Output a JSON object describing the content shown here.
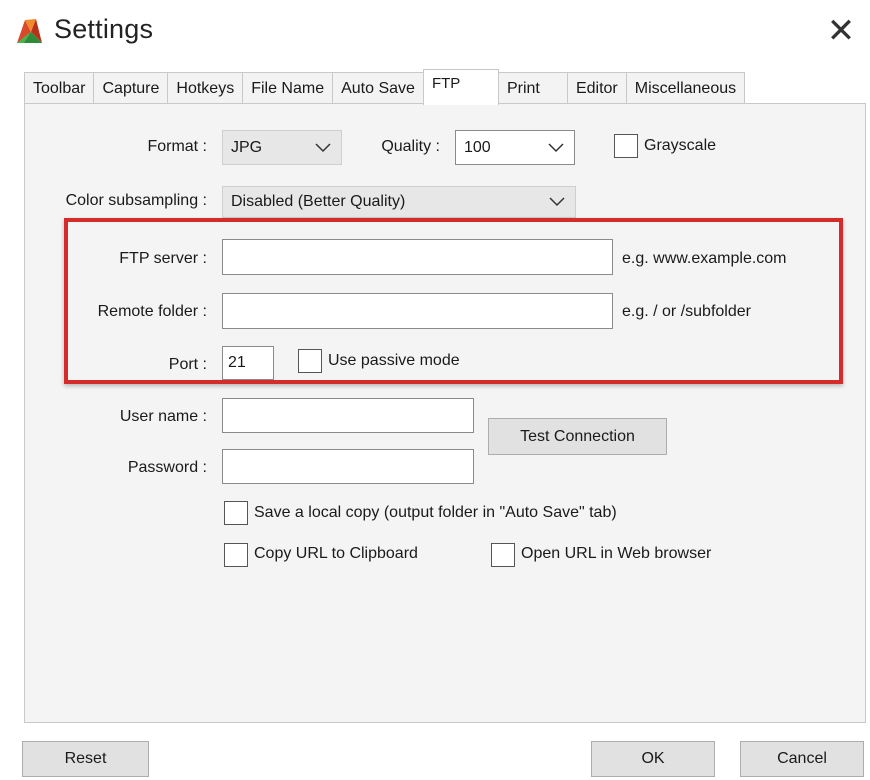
{
  "window": {
    "title": "Settings",
    "close_glyph": "✕",
    "icon": "app-logo-icon"
  },
  "tabs": [
    {
      "label": "Toolbar",
      "active": false
    },
    {
      "label": "Capture",
      "active": false
    },
    {
      "label": "Hotkeys",
      "active": false
    },
    {
      "label": "File Name",
      "active": false
    },
    {
      "label": "Auto Save",
      "active": false
    },
    {
      "label": "FTP",
      "active": true
    },
    {
      "label": "Print",
      "active": false
    },
    {
      "label": "Editor",
      "active": false
    },
    {
      "label": "Miscellaneous",
      "active": false
    }
  ],
  "format": {
    "label": "Format :",
    "value": "JPG"
  },
  "quality": {
    "label": "Quality :",
    "value": "100"
  },
  "grayscale": {
    "label": "Grayscale",
    "checked": false
  },
  "color_subsampling": {
    "label": "Color subsampling :",
    "value": "Disabled (Better Quality)"
  },
  "ftp_server": {
    "label": "FTP server :",
    "value": "",
    "hint": "e.g. www.example.com"
  },
  "remote_folder": {
    "label": "Remote folder :",
    "value": "",
    "hint": "e.g. / or /subfolder"
  },
  "port": {
    "label": "Port :",
    "value": "21"
  },
  "passive_mode": {
    "label": "Use passive mode",
    "checked": false
  },
  "user_name": {
    "label": "User name :",
    "value": ""
  },
  "password": {
    "label": "Password :",
    "value": ""
  },
  "test_connection": {
    "label": "Test Connection"
  },
  "save_local_copy": {
    "label": "Save a local copy (output folder in \"Auto Save\" tab)",
    "checked": false
  },
  "copy_url": {
    "label": "Copy URL to Clipboard",
    "checked": false
  },
  "open_url": {
    "label": "Open URL in Web browser",
    "checked": false
  },
  "footer": {
    "reset": "Reset",
    "ok": "OK",
    "cancel": "Cancel"
  },
  "colors": {
    "highlight": "#d42b2b",
    "panel_bg": "#f4f4f4",
    "button_bg": "#e1e1e1"
  }
}
